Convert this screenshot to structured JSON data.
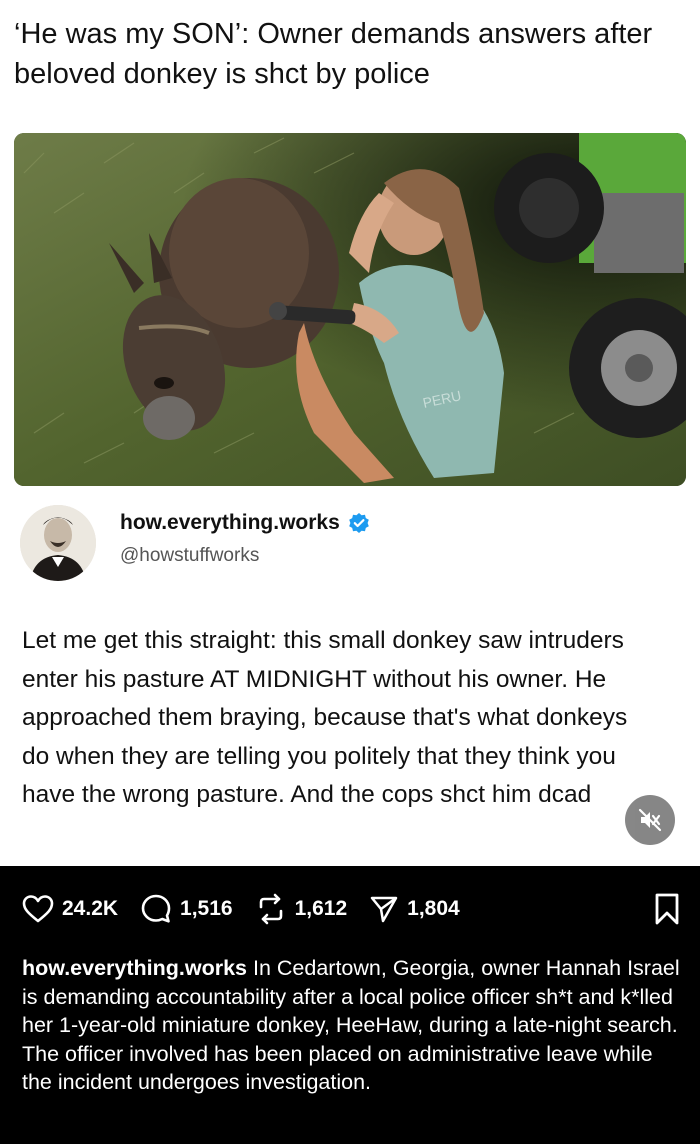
{
  "headline": "‘He was my SON’: Owner demands answers after beloved donkey is shct by police",
  "photo": {
    "shirt_text": "PERU"
  },
  "author": {
    "name": "how.everything.works",
    "handle": "@howstuffworks"
  },
  "tweet_text": "Let me get this straight: this small donkey saw intruders enter his pasture AT MIDNIGHT without his owner. He approached them braying, because that's what donkeys do when they are telling you politely that they think you have the wrong pasture. And the cops shct him dcad",
  "actions": {
    "likes": "24.2K",
    "comments": "1,516",
    "reposts": "1,612",
    "shares": "1,804"
  },
  "caption": {
    "username": "how.everything.works",
    "text": " In Cedartown, Georgia, owner Hannah Israel is demanding accountability after a local police officer sh*t and k*lled her 1-year-old miniature donkey, HeeHaw, during a late-night search. The officer involved has been placed on administrative leave while the incident undergoes investigation."
  },
  "colors": {
    "verified": "#1d9bf0",
    "dark_bg": "#000000",
    "mute_bg": "#7a7a7a"
  }
}
